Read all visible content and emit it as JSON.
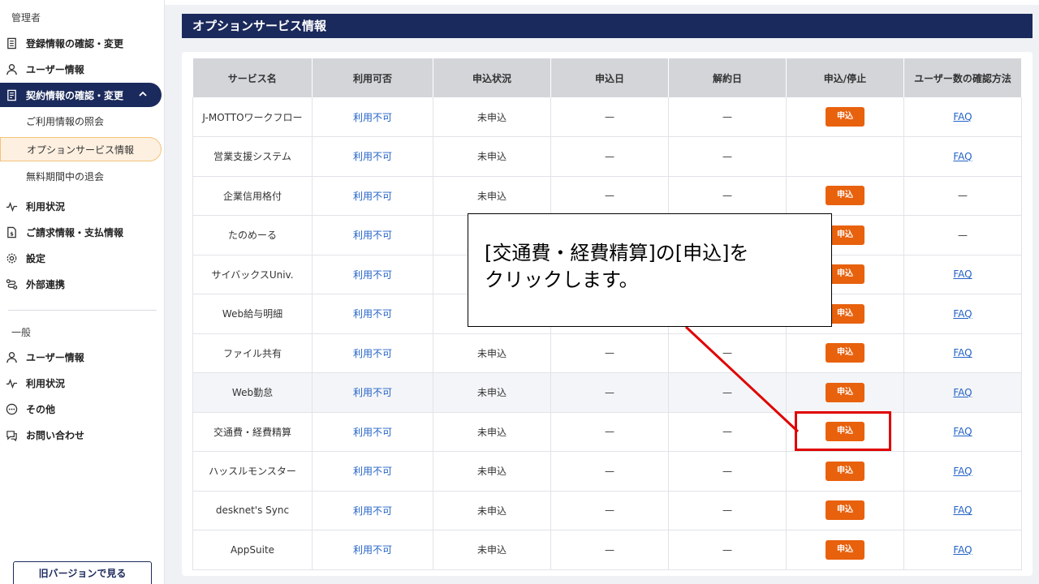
{
  "sidebar": {
    "admin_label": "管理者",
    "admin_items": [
      {
        "label": "登録情報の確認・変更",
        "icon": "document-icon"
      },
      {
        "label": "ユーザー情報",
        "icon": "user-icon"
      },
      {
        "label": "契約情報の確認・変更",
        "icon": "contract-icon"
      }
    ],
    "sub_items": [
      {
        "label": "ご利用情報の照会"
      },
      {
        "label": "オプションサービス情報"
      },
      {
        "label": "無料期間中の退会"
      }
    ],
    "admin_items2": [
      {
        "label": "利用状況",
        "icon": "activity-icon"
      },
      {
        "label": "ご請求情報・支払情報",
        "icon": "invoice-icon"
      },
      {
        "label": "設定",
        "icon": "gear-icon"
      },
      {
        "label": "外部連携",
        "icon": "link-icon"
      }
    ],
    "general_label": "一般",
    "general_items": [
      {
        "label": "ユーザー情報",
        "icon": "user-icon"
      },
      {
        "label": "利用状況",
        "icon": "activity-icon"
      },
      {
        "label": "その他",
        "icon": "more-icon"
      },
      {
        "label": "お問い合わせ",
        "icon": "chat-icon"
      }
    ],
    "old_version_button": "旧バージョンで見る"
  },
  "main": {
    "title": "オプションサービス情報",
    "table": {
      "headers": [
        "サービス名",
        "利用可否",
        "申込状況",
        "申込日",
        "解約日",
        "申込/停止",
        "ユーザー数の確認方法"
      ],
      "rows": [
        {
          "name": "J-MOTTOワークフロー",
          "availability": "利用不可",
          "status": "未申込",
          "applied": "—",
          "cancelled": "—",
          "button": "申込",
          "method": "FAQ"
        },
        {
          "name": "営業支援システム",
          "availability": "利用不可",
          "status": "未申込",
          "applied": "—",
          "cancelled": "—",
          "button": "",
          "method": "FAQ"
        },
        {
          "name": "企業信用格付",
          "availability": "利用不可",
          "status": "未申込",
          "applied": "—",
          "cancelled": "—",
          "button": "申込",
          "method": "—"
        },
        {
          "name": "たのめーる",
          "availability": "利用不可",
          "status": "",
          "applied": "",
          "cancelled": "",
          "button": "申込",
          "method": "—"
        },
        {
          "name": "サイバックスUniv.",
          "availability": "利用不可",
          "status": "",
          "applied": "",
          "cancelled": "",
          "button": "申込",
          "method": "FAQ"
        },
        {
          "name": "Web給与明細",
          "availability": "利用不可",
          "status": "",
          "applied": "",
          "cancelled": "",
          "button": "申込",
          "method": "FAQ"
        },
        {
          "name": "ファイル共有",
          "availability": "利用不可",
          "status": "未申込",
          "applied": "—",
          "cancelled": "—",
          "button": "申込",
          "method": "FAQ"
        },
        {
          "name": "Web勤怠",
          "availability": "利用不可",
          "status": "未申込",
          "applied": "—",
          "cancelled": "—",
          "button": "申込",
          "method": "FAQ"
        },
        {
          "name": "交通費・経費精算",
          "availability": "利用不可",
          "status": "未申込",
          "applied": "—",
          "cancelled": "—",
          "button": "申込",
          "method": "FAQ"
        },
        {
          "name": "ハッスルモンスター",
          "availability": "利用不可",
          "status": "未申込",
          "applied": "—",
          "cancelled": "—",
          "button": "申込",
          "method": "FAQ"
        },
        {
          "name": "desknet's Sync",
          "availability": "利用不可",
          "status": "未申込",
          "applied": "—",
          "cancelled": "—",
          "button": "申込",
          "method": "FAQ"
        },
        {
          "name": "AppSuite",
          "availability": "利用不可",
          "status": "未申込",
          "applied": "—",
          "cancelled": "—",
          "button": "申込",
          "method": "FAQ"
        }
      ]
    }
  },
  "callout": {
    "line1": "[交通費・経費精算]の[申込]を",
    "line2": "クリックします。"
  },
  "colors": {
    "navy": "#1b2a5c",
    "orange": "#e8610d",
    "highlight_red": "#e00000",
    "link_blue": "#2463c7"
  }
}
